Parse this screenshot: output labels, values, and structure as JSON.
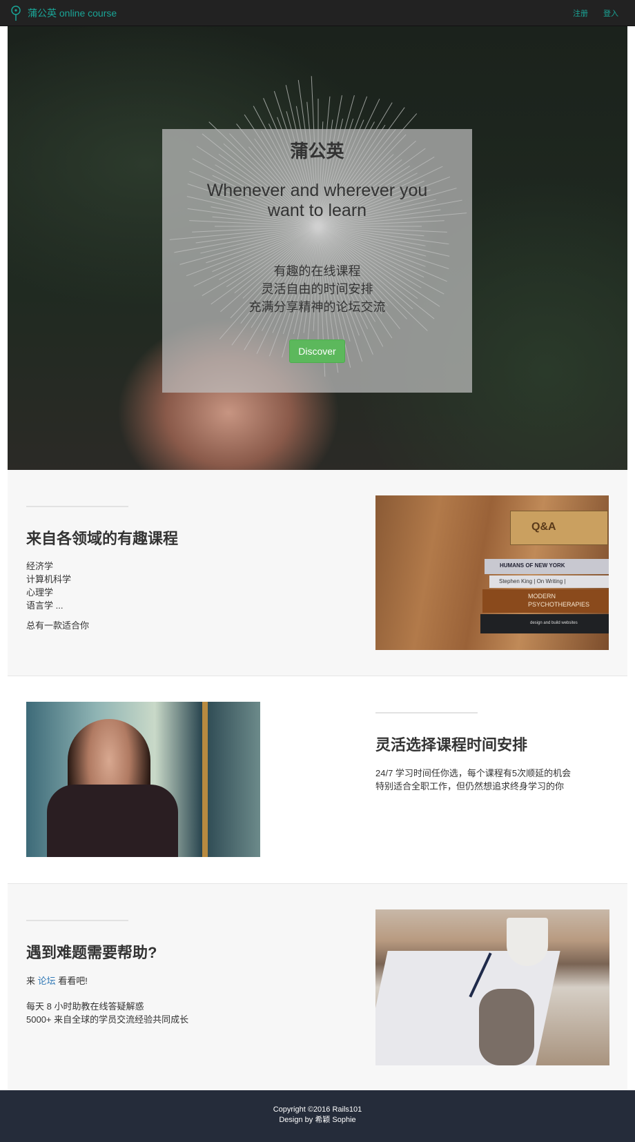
{
  "navbar": {
    "brand": "蒲公英 online course",
    "links": [
      "注册",
      "登入"
    ]
  },
  "hero": {
    "title": "蒲公英",
    "subtitle": "Whenever and wherever you want to learn",
    "features": [
      "有趣的在线课程",
      "灵活自由的时间安排",
      "充满分享精神的论坛交流"
    ],
    "button": "Discover"
  },
  "section1": {
    "title": "来自各领域的有趣课程",
    "items": [
      "经济学",
      "计算机科学",
      "心理学",
      "语言学 ..."
    ],
    "note": "总有一款适合你",
    "books": [
      "Q&A",
      "HUMANS OF NEW YORK",
      "Stephen King | On Writing |",
      "MODERN PSYCHOTHERAPIES",
      "design and build websites"
    ]
  },
  "section2": {
    "title": "灵活选择课程时间安排",
    "lines": [
      "24/7 学习时间任你选，每个课程有5次顺延的机会",
      "特别适合全职工作，但仍然想追求终身学习的你"
    ]
  },
  "section3": {
    "title": "遇到难题需要帮助?",
    "forum_prefix": "来",
    "forum_link": "论坛",
    "forum_suffix": "看看吧!",
    "lines": [
      "每天 8 小时助教在线答疑解惑",
      "5000+ 来自全球的学员交流经验共同成长"
    ]
  },
  "footer": {
    "copyright": "Copyright ©2016 Rails101",
    "design": "Design by 希颖 Sophie"
  },
  "colors": {
    "accent": "#1aa597",
    "button_green": "#5cb85c",
    "footer_bg": "#252c3a",
    "link_blue": "#337ab7"
  }
}
